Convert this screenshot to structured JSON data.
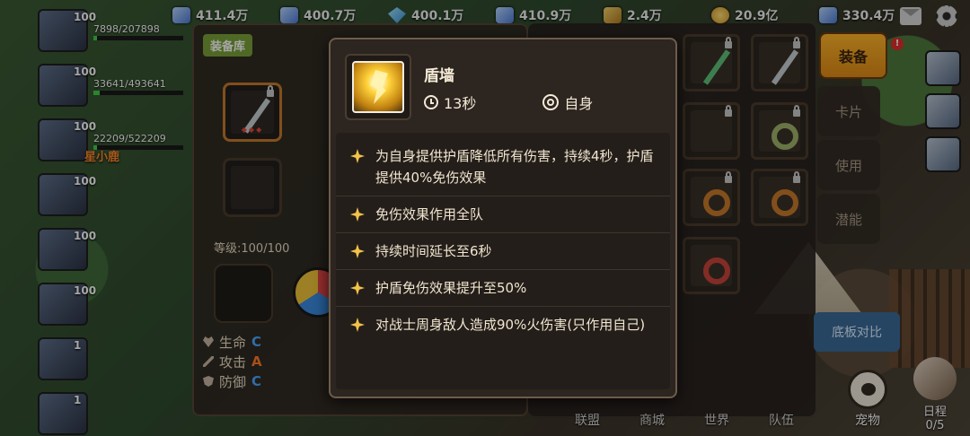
{
  "resources": [
    {
      "icon": "crystal-icon",
      "value": "411.4万"
    },
    {
      "icon": "ore-icon",
      "value": "400.7万"
    },
    {
      "icon": "diamond-icon",
      "value": "400.1万"
    },
    {
      "icon": "wood-icon",
      "value": "410.9万"
    },
    {
      "icon": "wheat-icon",
      "value": "2.4万"
    },
    {
      "icon": "gold-coin-icon",
      "value": "20.9亿"
    },
    {
      "icon": "gem-icon",
      "value": "330.4万"
    }
  ],
  "party": [
    {
      "level": "100",
      "hp": "7898/207898",
      "hp_fraction": 0.04
    },
    {
      "level": "100",
      "hp": "33641/493641",
      "hp_fraction": 0.07
    },
    {
      "level": "100",
      "hp": "22209/522209",
      "hp_fraction": 0.04
    },
    {
      "level": "100",
      "hp": "",
      "hp_fraction": 0
    },
    {
      "level": "100",
      "hp": "",
      "hp_fraction": 0
    },
    {
      "level": "100",
      "hp": "",
      "hp_fraction": 0
    },
    {
      "level": "1",
      "hp": "",
      "hp_fraction": 0
    },
    {
      "level": "1",
      "hp": "",
      "hp_fraction": 0
    }
  ],
  "party_highlight_name": "星小鹿",
  "equipment": {
    "tab_label": "装备库",
    "level": "等级:100/100",
    "stats": [
      {
        "icon": "heart-icon",
        "label": "生命",
        "grade": "C",
        "grade_color": "#4aa8ff"
      },
      {
        "icon": "sword-icon",
        "label": "攻击",
        "grade": "A",
        "grade_color": "#ff7a2a"
      },
      {
        "icon": "shield-icon",
        "label": "防御",
        "grade": "C",
        "grade_color": "#4aa8ff"
      }
    ]
  },
  "side_buttons": {
    "equip": "装备",
    "card": "卡片",
    "use": "使用",
    "potential": "潜能",
    "compare": "底板对比"
  },
  "bottom_nav": [
    "联盟",
    "商城",
    "世界",
    "队伍"
  ],
  "pet_label": "宠物",
  "schedule": {
    "label": "日程",
    "count": "0/5"
  },
  "tooltip": {
    "title": "盾墙",
    "cooldown": "13秒",
    "target": "自身",
    "effects": [
      "为自身提供护盾降低所有伤害，持续4秒，护盾提供40%免伤效果",
      "免伤效果作用全队",
      "持续时间延长至6秒",
      "护盾免伤效果提升至50%",
      "对战士周身敌人造成90%火伤害(只作用自己)"
    ]
  },
  "colors": {
    "accent": "#ffb52a",
    "panel": "#2c2520",
    "sparkle": "#f2c24a"
  }
}
